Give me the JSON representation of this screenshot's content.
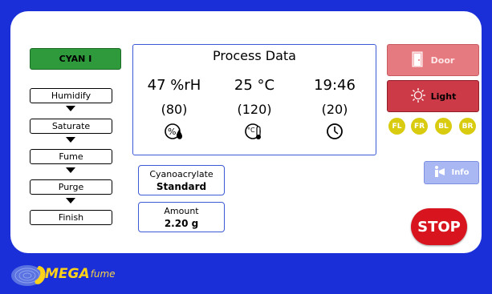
{
  "status": {
    "label": "CYAN I",
    "color": "#2f9a3c"
  },
  "steps": [
    "Humidify",
    "Saturate",
    "Fume",
    "Purge",
    "Finish"
  ],
  "process": {
    "title": "Process Data",
    "humidity": {
      "value": "47 %rH",
      "setpoint": "(80)",
      "icon": "humidity-icon"
    },
    "temperature": {
      "value": "25 °C",
      "setpoint": "(120)",
      "icon": "thermometer-icon"
    },
    "time": {
      "value": "19:46",
      "setpoint": "(20)",
      "icon": "clock-icon"
    }
  },
  "cyanoacrylate": {
    "label": "Cyanoacrylate",
    "value": "Standard"
  },
  "amount": {
    "label": "Amount",
    "value": "2.20 g"
  },
  "buttons": {
    "door": "Door",
    "light": "Light",
    "info": "Info",
    "stop": "STOP"
  },
  "fans": [
    "FL",
    "FR",
    "BL",
    "BR"
  ],
  "logo": {
    "brand": "MEGA",
    "suffix": "fume"
  },
  "colors": {
    "background": "#1a2fd8",
    "stop": "#d8141f",
    "light": "#cc3a47",
    "door": "#e57a80",
    "fan": "#d9cc10",
    "info": "#a9b8f2"
  }
}
